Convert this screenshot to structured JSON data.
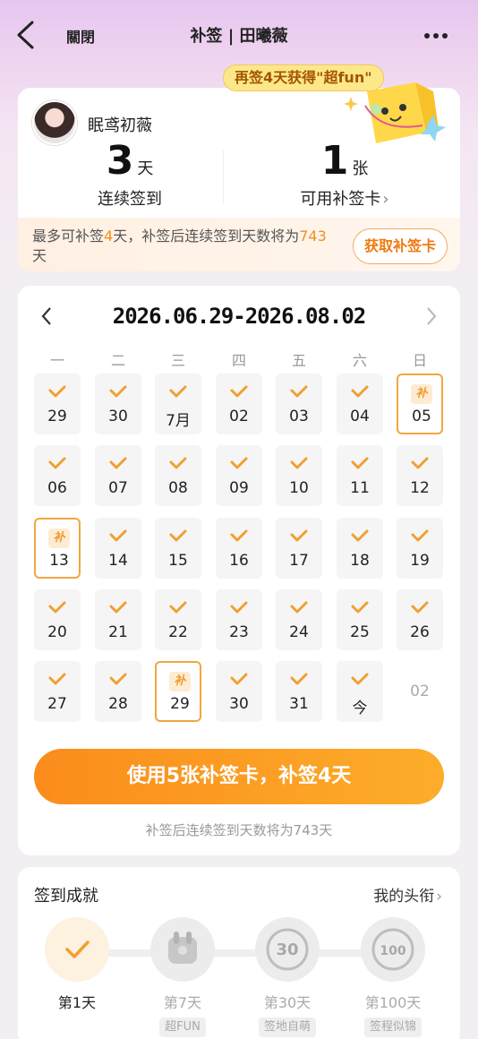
{
  "header": {
    "close_label": "關閉",
    "title": "补签 | 田曦薇"
  },
  "promo": {
    "text": "再签4天获得\"超fun\""
  },
  "user": {
    "name": "眠鸢初薇"
  },
  "stats": {
    "streak_value": "3",
    "streak_unit": "天",
    "streak_label": "连续签到",
    "cards_value": "1",
    "cards_unit": "张",
    "cards_label": "可用补签卡",
    "cards_chevron": "›"
  },
  "makeup_info": {
    "prefix": "最多可补签",
    "days": "4",
    "middle": "天，补签后连续签到天数将为",
    "total": "743",
    "suffix": "天",
    "button_label": "获取补签卡"
  },
  "calendar": {
    "range": "2026.06.29-2026.08.02",
    "weekdays": [
      "一",
      "二",
      "三",
      "四",
      "五",
      "六",
      "日"
    ],
    "bu_label": "补",
    "days": [
      {
        "label": "29",
        "state": "checked"
      },
      {
        "label": "30",
        "state": "checked"
      },
      {
        "label": "7月",
        "state": "checked"
      },
      {
        "label": "02",
        "state": "checked"
      },
      {
        "label": "03",
        "state": "checked"
      },
      {
        "label": "04",
        "state": "checked"
      },
      {
        "label": "05",
        "state": "makeup"
      },
      {
        "label": "06",
        "state": "checked"
      },
      {
        "label": "07",
        "state": "checked"
      },
      {
        "label": "08",
        "state": "checked"
      },
      {
        "label": "09",
        "state": "checked"
      },
      {
        "label": "10",
        "state": "checked"
      },
      {
        "label": "11",
        "state": "checked"
      },
      {
        "label": "12",
        "state": "checked"
      },
      {
        "label": "13",
        "state": "makeup"
      },
      {
        "label": "14",
        "state": "checked"
      },
      {
        "label": "15",
        "state": "checked"
      },
      {
        "label": "16",
        "state": "checked"
      },
      {
        "label": "17",
        "state": "checked"
      },
      {
        "label": "18",
        "state": "checked"
      },
      {
        "label": "19",
        "state": "checked"
      },
      {
        "label": "20",
        "state": "checked"
      },
      {
        "label": "21",
        "state": "checked"
      },
      {
        "label": "22",
        "state": "checked"
      },
      {
        "label": "23",
        "state": "checked"
      },
      {
        "label": "24",
        "state": "checked"
      },
      {
        "label": "25",
        "state": "checked"
      },
      {
        "label": "26",
        "state": "checked"
      },
      {
        "label": "27",
        "state": "checked"
      },
      {
        "label": "28",
        "state": "checked"
      },
      {
        "label": "29",
        "state": "makeup"
      },
      {
        "label": "30",
        "state": "checked"
      },
      {
        "label": "31",
        "state": "checked"
      },
      {
        "label": "今",
        "state": "checked"
      },
      {
        "label": "02",
        "state": "future"
      }
    ],
    "use_button_label": "使用5张补签卡，补签4天",
    "hint": "补签后连续签到天数将为743天"
  },
  "achievements": {
    "title": "签到成就",
    "link_label": "我的头衔",
    "link_chevron": "›",
    "badges": [
      {
        "label": "第1天",
        "tag": "",
        "active": true,
        "icon": "check-icon"
      },
      {
        "label": "第7天",
        "tag": "超FUN",
        "active": false,
        "icon": "hand-badge-icon"
      },
      {
        "label": "第30天",
        "tag": "签地自萌",
        "active": false,
        "icon": "30-days-badge-icon",
        "badge_text": "30"
      },
      {
        "label": "第100天",
        "tag": "签程似锦",
        "active": false,
        "icon": "100-days-badge-icon",
        "badge_text": "100"
      }
    ]
  },
  "colors": {
    "accent": "#f0901a",
    "check": "#f0a030",
    "button_start": "#fb8c1c",
    "button_end": "#fcad2a"
  }
}
